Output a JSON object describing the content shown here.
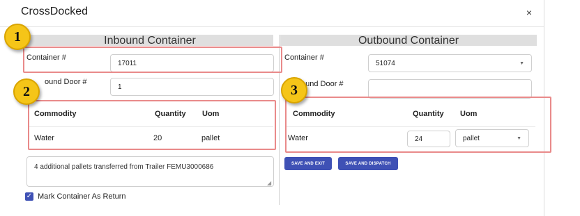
{
  "dialog": {
    "title": "CrossDocked",
    "close_glyph": "×"
  },
  "inbound": {
    "title": "Inbound Container",
    "container_label": "Container #",
    "container_value": "17011",
    "door_label": "ound Door #",
    "door_value": "1",
    "table": {
      "headers": [
        "Commodity",
        "Quantity",
        "Uom"
      ],
      "rows": [
        {
          "commodity": "Water",
          "quantity": "20",
          "uom": "pallet"
        }
      ]
    },
    "note": "4 additional pallets transferred from Trailer FEMU3000686",
    "checkbox_label": "Mark Container As Return",
    "checkbox_checked": true
  },
  "outbound": {
    "title": "Outbound Container",
    "container_label": "Container #",
    "container_value": "51074",
    "door_label": "ound Door #",
    "door_value": "",
    "table": {
      "headers": [
        "Commodity",
        "Quantity",
        "Uom"
      ],
      "rows": [
        {
          "commodity": "Water",
          "quantity": "24",
          "uom": "pallet"
        }
      ]
    },
    "save_exit_label": "SAVE AND EXIT",
    "save_dispatch_label": "SAVE AND DISPATCH"
  },
  "callouts": [
    "1",
    "2",
    "3"
  ],
  "colors": {
    "accent": "#3f51b5",
    "callout_fill": "#f5c518",
    "highlight_border": "#e98a8a"
  }
}
